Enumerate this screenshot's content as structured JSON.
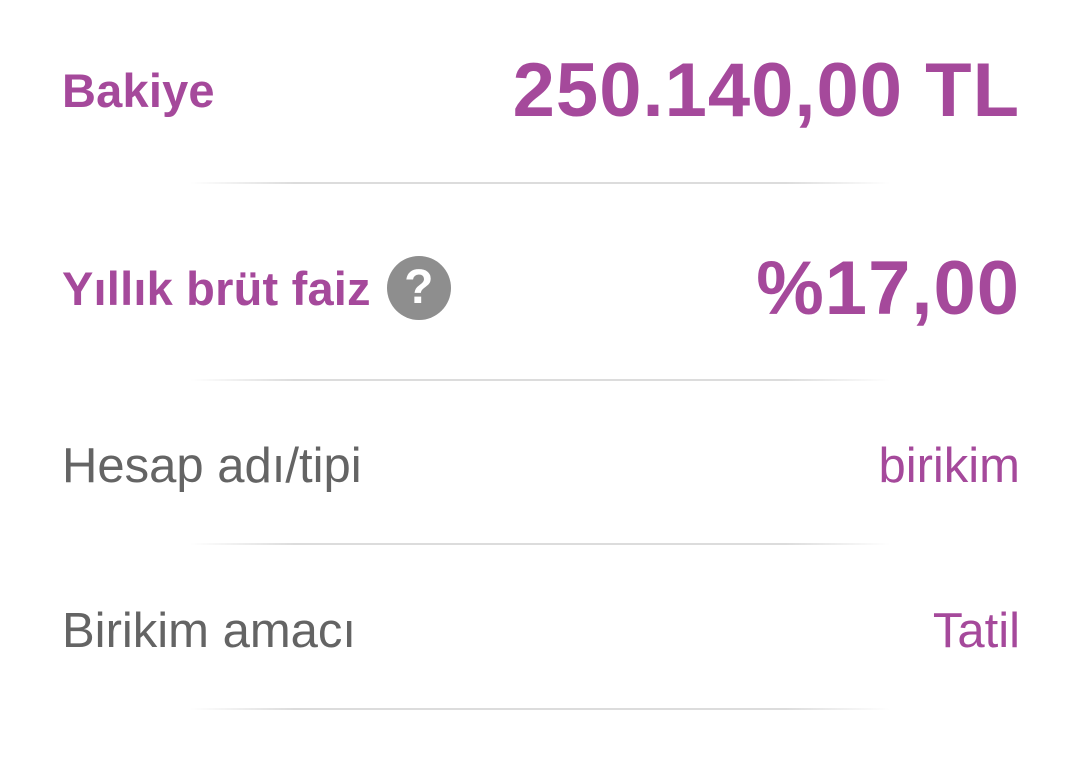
{
  "account": {
    "balance_label": "Bakiye",
    "balance_value": "250.140,00 TL",
    "rate_label": "Yıllık brüt faiz",
    "rate_help_icon": "?",
    "rate_value": "%17,00",
    "name_label": "Hesap adı/tipi",
    "name_value": "birikim",
    "purpose_label": "Birikim amacı",
    "purpose_value": "Tatil"
  },
  "colors": {
    "accent": "#a5499b",
    "label_gray": "#646464",
    "help_icon_bg": "#8e8e8e",
    "divider": "#dcdcdc"
  },
  "icons": {
    "help": "question-circle-icon"
  }
}
